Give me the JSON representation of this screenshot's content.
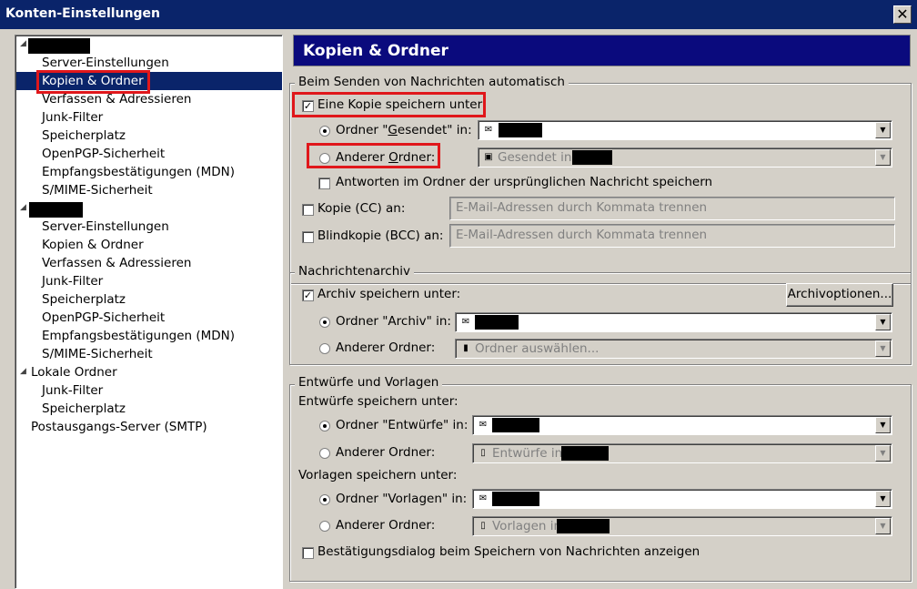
{
  "window": {
    "title": "Konten-Einstellungen",
    "close_glyph": "✕"
  },
  "tree": {
    "account1": {
      "items": [
        "Server-Einstellungen",
        "Kopien & Ordner",
        "Verfassen & Adressieren",
        "Junk-Filter",
        "Speicherplatz",
        "OpenPGP-Sicherheit",
        "Empfangsbestätigungen (MDN)",
        "S/MIME-Sicherheit"
      ],
      "selected": "Kopien & Ordner"
    },
    "account2": {
      "items": [
        "Server-Einstellungen",
        "Kopien & Ordner",
        "Verfassen & Adressieren",
        "Junk-Filter",
        "Speicherplatz",
        "OpenPGP-Sicherheit",
        "Empfangsbestätigungen (MDN)",
        "S/MIME-Sicherheit"
      ]
    },
    "local": {
      "label": "Lokale Ordner",
      "items": [
        "Junk-Filter",
        "Speicherplatz"
      ]
    },
    "smtp": "Postausgangs-Server (SMTP)"
  },
  "panel": {
    "header": "Kopien & Ordner",
    "sending": {
      "legend": "Beim Senden von Nachrichten automatisch",
      "save_copy": {
        "label": "Eine Kopie speichern unter:",
        "checked": true
      },
      "folder_sent": {
        "label_pre": "Ordner \"",
        "label_u": "G",
        "label_post": "esendet\" in:",
        "selected": true
      },
      "other_folder": {
        "label_pre": "Anderer ",
        "label_u": "O",
        "label_post": "rdner:",
        "selected": false,
        "value": "Gesendet in"
      },
      "reply_in_folder": {
        "label": "Antworten im Ordner der ursprünglichen Nachricht speichern",
        "checked": false
      },
      "cc": {
        "label": "Kopie (CC) an:",
        "placeholder": "E-Mail-Adressen durch Kommata trennen",
        "checked": false
      },
      "bcc": {
        "label": "Blindkopie (BCC) an:",
        "placeholder": "E-Mail-Adressen durch Kommata trennen",
        "checked": false
      }
    },
    "archive": {
      "legend": "Nachrichtenarchiv",
      "save_archive": {
        "label": "Archiv speichern unter:",
        "checked": true
      },
      "options_button": "Archivoptionen...",
      "folder_archive": {
        "label": "Ordner \"Archiv\" in:",
        "selected": true
      },
      "other_folder": {
        "label": "Anderer Ordner:",
        "selected": false,
        "value": "Ordner auswählen..."
      }
    },
    "drafts": {
      "legend": "Entwürfe und Vorlagen",
      "drafts_heading": "Entwürfe speichern unter:",
      "folder_drafts": {
        "label": "Ordner \"Entwürfe\" in:",
        "selected": true
      },
      "other_drafts": {
        "label": "Anderer Ordner:",
        "selected": false,
        "value": "Entwürfe in"
      },
      "templates_heading": "Vorlagen speichern unter:",
      "folder_templates": {
        "label": "Ordner \"Vorlagen\" in:",
        "selected": true
      },
      "other_templates": {
        "label": "Anderer Ordner:",
        "selected": false,
        "value": "Vorlagen in"
      },
      "confirm_dialog": {
        "label": "Bestätigungsdialog beim Speichern von Nachrichten anzeigen",
        "checked": false
      }
    }
  },
  "colors": {
    "selection": "#0a246a",
    "header": "#0a0a7d",
    "highlight_box": "#e0171b",
    "face": "#d4d0c8"
  },
  "icons": {
    "dropdown": "dropdown-arrow-icon",
    "account": "mail-account-icon",
    "folder": "folder-icon",
    "expand": "collapse-triangle-icon"
  }
}
